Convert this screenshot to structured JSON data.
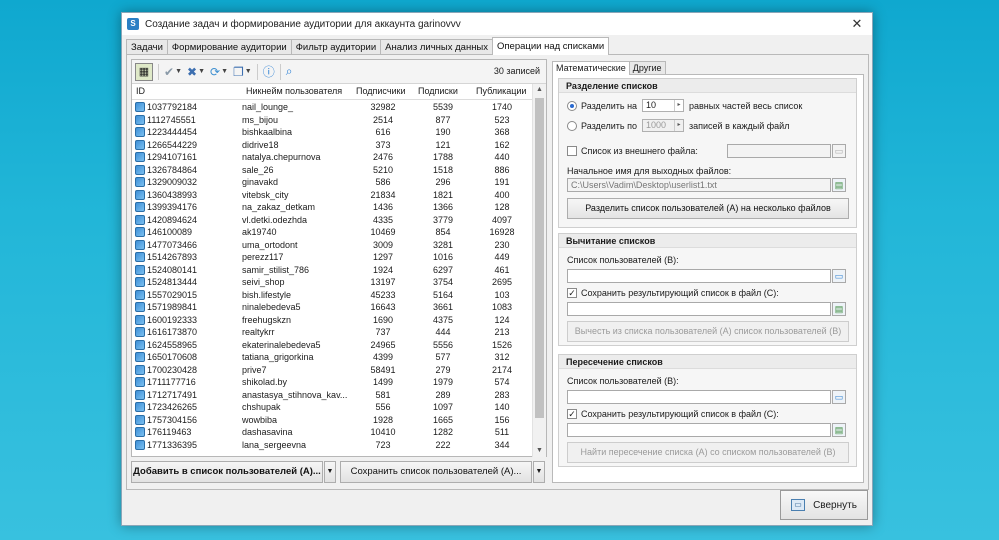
{
  "window": {
    "title": "Создание задач и формирование аудитории для аккаунта garinovvv",
    "close_symbol": "✕"
  },
  "tabs": [
    {
      "label": "Задачи"
    },
    {
      "label": "Формирование аудитории"
    },
    {
      "label": "Фильтр аудитории"
    },
    {
      "label": "Анализ личных данных"
    },
    {
      "label": "Операции над списками"
    }
  ],
  "toolbar": {
    "records_count": "30 записей",
    "icons": [
      "select-all-icon",
      "check-icon",
      "delete-icon",
      "refresh-icon",
      "copy-icon",
      "info-icon",
      "search-icon"
    ]
  },
  "table": {
    "columns": [
      "ID",
      "Никнейм пользователя",
      "Подписчики",
      "Подписки",
      "Публикации"
    ],
    "rows": [
      [
        "1037792184",
        "nail_lounge_",
        "32982",
        "5539",
        "1740"
      ],
      [
        "1112745551",
        "ms_bijou",
        "2514",
        "877",
        "523"
      ],
      [
        "1223444454",
        "bishkaalbina",
        "616",
        "190",
        "368"
      ],
      [
        "1266544229",
        "didrive18",
        "373",
        "121",
        "162"
      ],
      [
        "1294107161",
        "natalya.chepurnova",
        "2476",
        "1788",
        "440"
      ],
      [
        "1326784864",
        "sale_26",
        "5210",
        "1518",
        "886"
      ],
      [
        "1329009032",
        "ginavakd",
        "586",
        "296",
        "191"
      ],
      [
        "1360438993",
        "vitebsk_city",
        "21834",
        "1821",
        "400"
      ],
      [
        "1399394176",
        "na_zakaz_detkam",
        "1436",
        "1366",
        "128"
      ],
      [
        "1420894624",
        "vl.detki.odezhda",
        "4335",
        "3779",
        "4097"
      ],
      [
        "146100089",
        "ak19740",
        "10469",
        "854",
        "16928"
      ],
      [
        "1477073466",
        "uma_ortodont",
        "3009",
        "3281",
        "230"
      ],
      [
        "1514267893",
        "perezz117",
        "1297",
        "1016",
        "449"
      ],
      [
        "1524080141",
        "samir_stilist_786",
        "1924",
        "6297",
        "461"
      ],
      [
        "1524813444",
        "seivi_shop",
        "13197",
        "3754",
        "2695"
      ],
      [
        "1557029015",
        "bish.lifestyle",
        "45233",
        "5164",
        "103"
      ],
      [
        "1571989841",
        "ninalebedeva5",
        "16643",
        "3661",
        "1083"
      ],
      [
        "1600192333",
        "freehugskzn",
        "1690",
        "4375",
        "124"
      ],
      [
        "1616173870",
        "realtykrr",
        "737",
        "444",
        "213"
      ],
      [
        "1624558965",
        "ekaterinalebedeva5",
        "24965",
        "5556",
        "1526"
      ],
      [
        "1650170608",
        "tatiana_grigorkina",
        "4399",
        "577",
        "312"
      ],
      [
        "1700230428",
        "prive7",
        "58491",
        "279",
        "2174"
      ],
      [
        "1711177716",
        "shikolad.by",
        "1499",
        "1979",
        "574"
      ],
      [
        "1712717491",
        "anastasya_stihnova_kav...",
        "581",
        "289",
        "283"
      ],
      [
        "1723426265",
        "chshupak",
        "556",
        "1097",
        "140"
      ],
      [
        "1757304156",
        "wowbiba",
        "1928",
        "1665",
        "156"
      ],
      [
        "176119463",
        "dashasavina",
        "10410",
        "1282",
        "511"
      ],
      [
        "1771336395",
        "lana_sergeevna",
        "723",
        "222",
        "344"
      ]
    ]
  },
  "left_buttons": {
    "add_to_list": "Добавить в список пользователей (А)...",
    "save_list": "Сохранить список пользователей (А)..."
  },
  "right_tabs": [
    {
      "label": "Математические"
    },
    {
      "label": "Другие"
    }
  ],
  "split": {
    "title": "Разделение списков",
    "radio1_label": "Разделить на",
    "radio1_value": "10",
    "radio1_suffix": "равных частей весь список",
    "radio2_label": "Разделить по",
    "radio2_value": "1000",
    "radio2_suffix": "записей в каждый файл",
    "external_label": "Список из внешнего файла:",
    "output_label": "Начальное имя для выходных файлов:",
    "output_path": "C:\\Users\\Vadim\\Desktop\\userlist1.txt",
    "button": "Разделить список пользователей (А) на несколько файлов"
  },
  "subtract": {
    "title": "Вычитание списков",
    "list_b_label": "Список пользователей (В):",
    "save_label": "Сохранить результирующий список в файл (С):",
    "button": "Вычесть из списка пользователей (А) список пользователей (В)"
  },
  "intersect": {
    "title": "Пересечение списков",
    "list_b_label": "Список пользователей (В):",
    "save_label": "Сохранить результирующий список в файл (С):",
    "button": "Найти пересечение списка (А) со списком пользователей (В)"
  },
  "footer": {
    "collapse_label": "Свернуть"
  }
}
